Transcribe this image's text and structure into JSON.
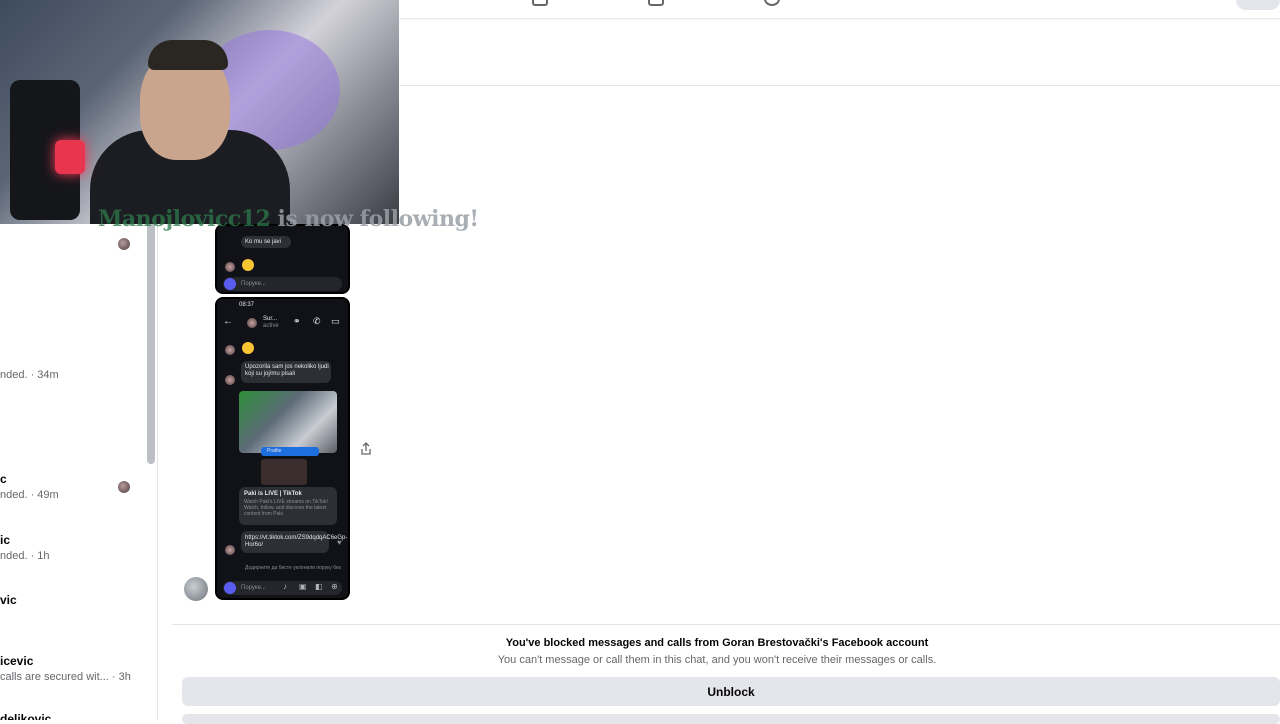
{
  "stream_overlay": {
    "follower_name": "Manojlovicc12",
    "follow_text": "is now following!"
  },
  "sidebar": {
    "conversations": [
      {
        "name": "",
        "preview": "nded. · 34m"
      },
      {
        "name": "c",
        "preview": "nded. · 49m"
      },
      {
        "name": "ic",
        "preview": "nded. · 1h"
      },
      {
        "name": "vic",
        "preview": ""
      },
      {
        "name": "icevic",
        "preview": "calls are secured wit... · 3h"
      },
      {
        "name": "delikovic",
        "preview": ""
      }
    ]
  },
  "shared_screenshots": {
    "top_phone": {
      "message_1": "Ko mu se javi",
      "input_placeholder": "Поруке..."
    },
    "bottom_phone": {
      "status_time": "08:37",
      "contact_name": "Sur...",
      "contact_sub": "active",
      "message_warning": "Upozorila sam jos nekoliko ljudi koji su joj/mu pisali",
      "live_badge": "Pratite",
      "link_card_title": "Paki is LIVE | TikTok",
      "link_card_desc": "Watch Paki's LIVE streams on TikTok! Watch, follow, and discover the latest content from Paki",
      "link_url": "https://vt.tiktok.com/ZS9dqdqAC6eGp-Hor6o/",
      "link_note": "Додирните да бисте уклонили поруку без",
      "input_placeholder": "Поруке..."
    }
  },
  "blocked_banner": {
    "title": "You've blocked messages and calls from Goran Brestovački's Facebook account",
    "description": "You can't message or call them in this chat, and you won't receive their messages or calls.",
    "unblock_label": "Unblock"
  },
  "icons": [
    "grid-icon",
    "phone-icon",
    "person-icon",
    "share-icon",
    "camera-icon",
    "mic-icon",
    "image-icon",
    "sticker-icon",
    "plus-icon",
    "back-arrow-icon",
    "link-icon",
    "call-icon",
    "video-icon",
    "heart-icon"
  ],
  "colors": {
    "accent": "#5a5cf0",
    "button_bg": "#e4e6eb",
    "muted_text": "#65676b"
  }
}
